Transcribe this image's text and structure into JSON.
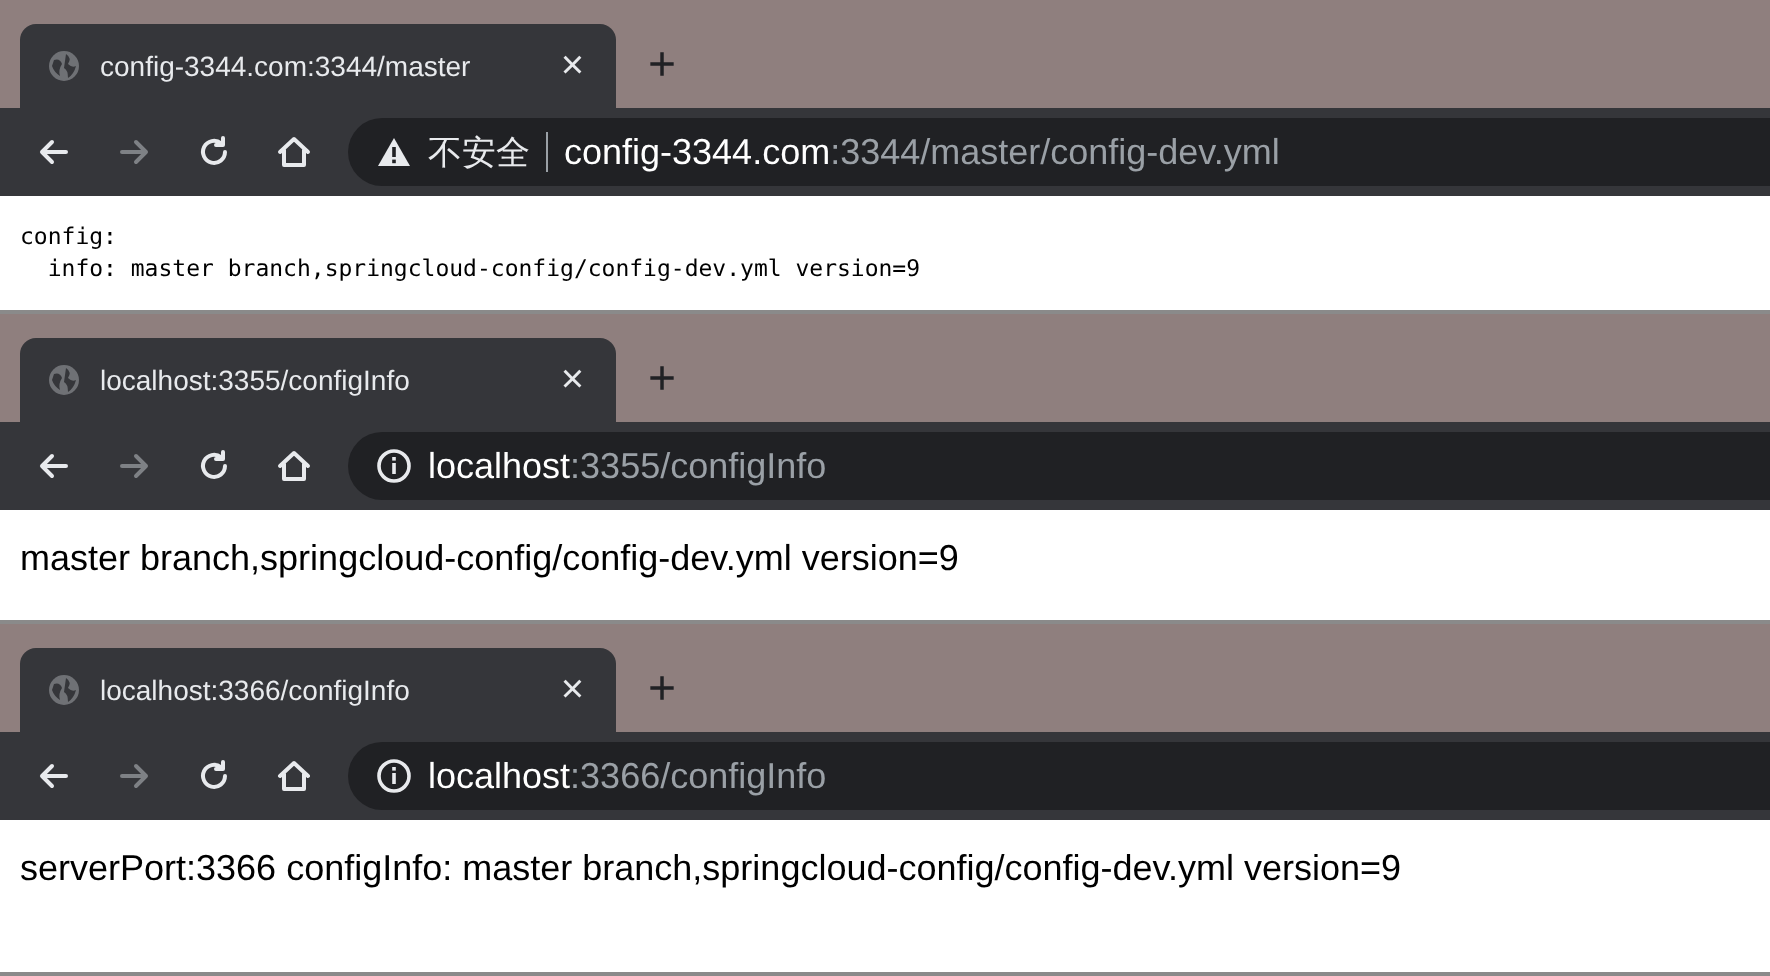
{
  "windows": [
    {
      "tab": {
        "title": "config-3344.com:3344/master",
        "close": "×"
      },
      "new_tab": "+",
      "nav": {
        "forward_disabled": true
      },
      "security": {
        "kind": "warning",
        "label": "不安全"
      },
      "url": {
        "host": "config-3344.com",
        "rest": ":3344/master/config-dev.yml"
      },
      "content": {
        "kind": "code",
        "lines": [
          "config:",
          "  info: master branch,springcloud-config/config-dev.yml version=9"
        ]
      }
    },
    {
      "tab": {
        "title": "localhost:3355/configInfo",
        "close": "×"
      },
      "new_tab": "+",
      "nav": {
        "forward_disabled": true
      },
      "security": {
        "kind": "info"
      },
      "url": {
        "host": "localhost",
        "rest": ":3355/configInfo"
      },
      "content": {
        "kind": "text",
        "lines": [
          "master branch,springcloud-config/config-dev.yml version=9"
        ]
      }
    },
    {
      "tab": {
        "title": "localhost:3366/configInfo",
        "close": "×"
      },
      "new_tab": "+",
      "nav": {
        "forward_disabled": true
      },
      "security": {
        "kind": "info"
      },
      "url": {
        "host": "localhost",
        "rest": ":3366/configInfo"
      },
      "content": {
        "kind": "text",
        "lines": [
          "serverPort:3366 configInfo: master branch,springcloud-config/config-dev.yml version=9"
        ]
      }
    }
  ]
}
